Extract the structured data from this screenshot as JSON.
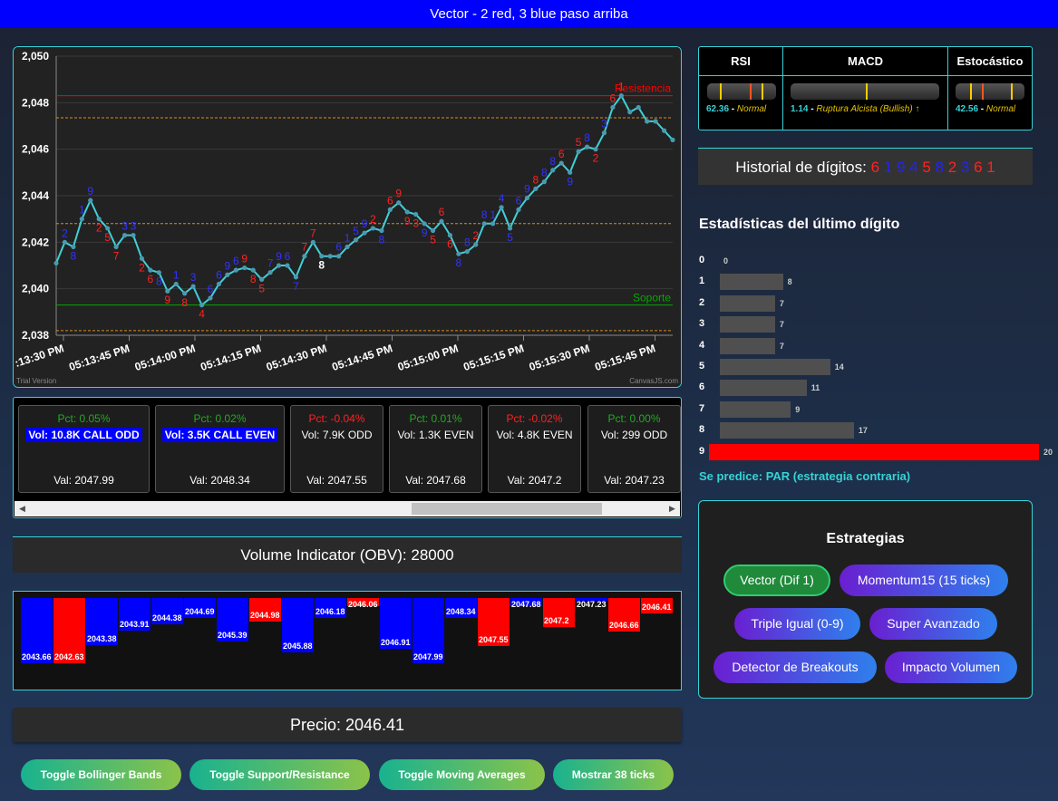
{
  "header": {
    "title": "Vector - 2 red, 3 blue paso arriba"
  },
  "chart": {
    "chart_data": {
      "type": "line",
      "ylim": [
        2038,
        2050
      ],
      "y_ticks": [
        "2,038",
        "2,040",
        "2,042",
        "2,044",
        "2,046",
        "2,048",
        "2,050"
      ],
      "x_ticks": [
        ":13:30 PM",
        "05:13:45 PM",
        "05:14:00 PM",
        "05:14:15 PM",
        "05:14:30 PM",
        "05:14:45 PM",
        "05:15:00 PM",
        "05:15:15 PM",
        "05:15:30 PM",
        "05:15:45 PM"
      ],
      "resistance": {
        "label": "Resistencia",
        "value": 2048.3,
        "color": "#ff0000"
      },
      "support": {
        "label": "Soporte",
        "value": 2039.3,
        "color": "#00aa00"
      },
      "dotted_levels": [
        2047.35,
        2042.8,
        2038.2
      ],
      "line_color": "#3fd0d8",
      "values": [
        2041.1,
        2042.0,
        2041.8,
        2043.0,
        2043.8,
        2043.0,
        2042.6,
        2041.8,
        2042.3,
        2042.3,
        2041.3,
        2040.8,
        2040.7,
        2039.9,
        2040.2,
        2039.8,
        2040.1,
        2039.3,
        2039.6,
        2040.2,
        2040.6,
        2040.8,
        2040.9,
        2040.8,
        2040.4,
        2040.7,
        2041.0,
        2041.0,
        2040.5,
        2041.4,
        2042.0,
        2041.4,
        2041.4,
        2041.4,
        2041.8,
        2042.1,
        2042.4,
        2042.6,
        2042.5,
        2043.4,
        2043.7,
        2043.3,
        2043.2,
        2042.8,
        2042.5,
        2042.9,
        2042.3,
        2041.5,
        2041.6,
        2041.9,
        2042.8,
        2042.8,
        2043.5,
        2042.6,
        2043.4,
        2043.9,
        2044.3,
        2044.6,
        2045.1,
        2045.4,
        2045.0,
        2045.9,
        2046.1,
        2046.0,
        2046.7,
        2047.8,
        2048.3,
        2047.6,
        2047.8,
        2047.2,
        2047.2,
        2046.8,
        2046.4
      ],
      "digit_labels": [
        {
          "i": 1,
          "t": "2",
          "c": "b"
        },
        {
          "i": 2,
          "t": "8",
          "c": "b"
        },
        {
          "i": 3,
          "t": "1",
          "c": "b"
        },
        {
          "i": 4,
          "t": "9",
          "c": "b"
        },
        {
          "i": 5,
          "t": "2",
          "c": "r"
        },
        {
          "i": 6,
          "t": "5",
          "c": "r"
        },
        {
          "i": 7,
          "t": "7",
          "c": "r"
        },
        {
          "i": 8,
          "t": "3",
          "c": "b"
        },
        {
          "i": 9,
          "t": "3",
          "c": "b"
        },
        {
          "i": 10,
          "t": "2",
          "c": "r"
        },
        {
          "i": 11,
          "t": "6",
          "c": "r"
        },
        {
          "i": 12,
          "t": "8",
          "c": "b"
        },
        {
          "i": 13,
          "t": "9",
          "c": "r"
        },
        {
          "i": 14,
          "t": "1",
          "c": "b"
        },
        {
          "i": 15,
          "t": "8",
          "c": "r"
        },
        {
          "i": 16,
          "t": "3",
          "c": "b"
        },
        {
          "i": 17,
          "t": "4",
          "c": "r"
        },
        {
          "i": 18,
          "t": "6",
          "c": "b"
        },
        {
          "i": 19,
          "t": "6",
          "c": "b"
        },
        {
          "i": 20,
          "t": "9",
          "c": "b"
        },
        {
          "i": 21,
          "t": "6",
          "c": "b"
        },
        {
          "i": 22,
          "t": "9",
          "c": "r"
        },
        {
          "i": 23,
          "t": "8",
          "c": "r"
        },
        {
          "i": 24,
          "t": "5",
          "c": "r"
        },
        {
          "i": 25,
          "t": "7",
          "c": "b"
        },
        {
          "i": 26,
          "t": "9",
          "c": "b"
        },
        {
          "i": 27,
          "t": "6",
          "c": "b"
        },
        {
          "i": 28,
          "t": "7",
          "c": "b"
        },
        {
          "i": 29,
          "t": "7",
          "c": "r"
        },
        {
          "i": 30,
          "t": "7",
          "c": "r"
        },
        {
          "i": 31,
          "t": "8",
          "c": "w"
        },
        {
          "i": 33,
          "t": "6",
          "c": "b"
        },
        {
          "i": 34,
          "t": "1",
          "c": "b"
        },
        {
          "i": 35,
          "t": "5",
          "c": "b"
        },
        {
          "i": 36,
          "t": "9",
          "c": "b"
        },
        {
          "i": 37,
          "t": "2",
          "c": "r"
        },
        {
          "i": 38,
          "t": "8",
          "c": "b"
        },
        {
          "i": 39,
          "t": "6",
          "c": "r"
        },
        {
          "i": 40,
          "t": "9",
          "c": "r"
        },
        {
          "i": 41,
          "t": "9",
          "c": "r"
        },
        {
          "i": 42,
          "t": "3",
          "c": "r"
        },
        {
          "i": 43,
          "t": "9",
          "c": "b"
        },
        {
          "i": 44,
          "t": "5",
          "c": "r"
        },
        {
          "i": 45,
          "t": "6",
          "c": "r"
        },
        {
          "i": 46,
          "t": "6",
          "c": "r"
        },
        {
          "i": 47,
          "t": "8",
          "c": "b"
        },
        {
          "i": 48,
          "t": "8",
          "c": "b"
        },
        {
          "i": 49,
          "t": "2",
          "c": "r"
        },
        {
          "i": 50,
          "t": "8",
          "c": "b"
        },
        {
          "i": 51,
          "t": "1",
          "c": "b"
        },
        {
          "i": 52,
          "t": "4",
          "c": "b"
        },
        {
          "i": 53,
          "t": "5",
          "c": "b"
        },
        {
          "i": 54,
          "t": "6",
          "c": "b"
        },
        {
          "i": 55,
          "t": "9",
          "c": "b"
        },
        {
          "i": 56,
          "t": "8",
          "c": "r"
        },
        {
          "i": 57,
          "t": "8",
          "c": "b"
        },
        {
          "i": 58,
          "t": "8",
          "c": "b"
        },
        {
          "i": 59,
          "t": "6",
          "c": "r"
        },
        {
          "i": 60,
          "t": "9",
          "c": "b"
        },
        {
          "i": 61,
          "t": "5",
          "c": "r"
        },
        {
          "i": 62,
          "t": "8",
          "c": "b"
        },
        {
          "i": 63,
          "t": "2",
          "c": "r"
        },
        {
          "i": 64,
          "t": "3",
          "c": "b"
        },
        {
          "i": 65,
          "t": "6",
          "c": "r"
        },
        {
          "i": 66,
          "t": "1",
          "c": "r"
        }
      ],
      "watermark_left": "Trial Version",
      "watermark_right": "CanvasJS.com"
    }
  },
  "ticks": [
    {
      "pct": "Pct: 0.05%",
      "pct_color": "#22aa22",
      "vol": "Vol: 10.8K CALL ODD",
      "highlight": true,
      "val": "Val: 2047.99"
    },
    {
      "pct": "Pct: 0.02%",
      "pct_color": "#22aa22",
      "vol": "Vol: 3.5K CALL EVEN",
      "highlight": true,
      "val": "Val: 2048.34"
    },
    {
      "pct": "Pct: -0.04%",
      "pct_color": "#ff2222",
      "vol": "Vol: 7.9K ODD",
      "highlight": false,
      "val": "Val: 2047.55"
    },
    {
      "pct": "Pct: 0.01%",
      "pct_color": "#22aa22",
      "vol": "Vol: 1.3K EVEN",
      "highlight": false,
      "val": "Val: 2047.68"
    },
    {
      "pct": "Pct: -0.02%",
      "pct_color": "#ff2222",
      "vol": "Vol: 4.8K EVEN",
      "highlight": false,
      "val": "Val: 2047.2"
    },
    {
      "pct": "Pct: 0.00%",
      "pct_color": "#22aa22",
      "vol": "Vol: 299 ODD",
      "highlight": false,
      "val": "Val: 2047.23"
    }
  ],
  "scroll": {
    "left": "◀",
    "right": "▶"
  },
  "obv": {
    "text": "Volume Indicator (OBV): 28000"
  },
  "vol_bars": [
    {
      "v": "2043.66",
      "c": "blue",
      "d": 1.0
    },
    {
      "v": "2042.63",
      "c": "red",
      "d": 1.0
    },
    {
      "v": "2043.38",
      "c": "blue",
      "d": 0.72
    },
    {
      "v": "2043.91",
      "c": "blue",
      "d": 0.5
    },
    {
      "v": "2044.38",
      "c": "blue",
      "d": 0.4
    },
    {
      "v": "2044.69",
      "c": "blue",
      "d": 0.3
    },
    {
      "v": "2045.39",
      "c": "blue",
      "d": 0.67
    },
    {
      "v": "2044.98",
      "c": "red",
      "d": 0.36
    },
    {
      "v": "2045.88",
      "c": "blue",
      "d": 0.83
    },
    {
      "v": "2046.18",
      "c": "blue",
      "d": 0.3
    },
    {
      "v": "2046.06",
      "c": "red",
      "d": 0.12
    },
    {
      "v": "2046.91",
      "c": "blue",
      "d": 0.78
    },
    {
      "v": "2047.99",
      "c": "blue",
      "d": 1.0
    },
    {
      "v": "2048.34",
      "c": "blue",
      "d": 0.3
    },
    {
      "v": "2047.55",
      "c": "red",
      "d": 0.74
    },
    {
      "v": "2047.68",
      "c": "blue",
      "d": 0.12
    },
    {
      "v": "2047.2",
      "c": "red",
      "d": 0.45
    },
    {
      "v": "2047.23",
      "c": "blue",
      "d": 0.03
    },
    {
      "v": "2046.66",
      "c": "red",
      "d": 0.52
    },
    {
      "v": "2046.41",
      "c": "red",
      "d": 0.23
    }
  ],
  "price": {
    "text": "Precio: 2046.41"
  },
  "toggles": [
    "Toggle Bollinger Bands",
    "Toggle Support/Resistance",
    "Toggle Moving Averages",
    "Mostrar 38 ticks"
  ],
  "indicators": {
    "rsi": {
      "title": "RSI",
      "value": "62.36",
      "sep": " - ",
      "status": "Normal"
    },
    "macd": {
      "title": "MACD",
      "value": "1.14",
      "sep": " - ",
      "status": "Ruptura Alcista (Bullish) ↑"
    },
    "stoch": {
      "title": "Estocástico",
      "value": "42.56",
      "sep": " - ",
      "status": "Normal"
    }
  },
  "digits": {
    "label": "Historial de dígitos:",
    "seq": [
      {
        "d": "6",
        "c": "#ff2222"
      },
      {
        "d": "1",
        "c": "#2222ff"
      },
      {
        "d": "9",
        "c": "#2222ff"
      },
      {
        "d": "4",
        "c": "#2222ff"
      },
      {
        "d": "5",
        "c": "#ff2222"
      },
      {
        "d": "8",
        "c": "#2222ff"
      },
      {
        "d": "2",
        "c": "#ff2222"
      },
      {
        "d": "3",
        "c": "#2222ff"
      },
      {
        "d": "6",
        "c": "#ff2222"
      },
      {
        "d": "1",
        "c": "#ff2222"
      }
    ]
  },
  "stats": {
    "title": "Estadísticas del último dígito",
    "rows": [
      {
        "d": "0",
        "n": 0
      },
      {
        "d": "1",
        "n": 8
      },
      {
        "d": "2",
        "n": 7
      },
      {
        "d": "3",
        "n": 7
      },
      {
        "d": "4",
        "n": 7
      },
      {
        "d": "5",
        "n": 14
      },
      {
        "d": "6",
        "n": 11
      },
      {
        "d": "7",
        "n": 9
      },
      {
        "d": "8",
        "n": 17
      },
      {
        "d": "9",
        "n": 20
      }
    ],
    "max_color": "#ff0000"
  },
  "prediction": {
    "text": "Se predice: PAR (estrategia contraria)"
  },
  "strategies": {
    "title": "Estrategias",
    "buttons": [
      "Vector (Dif 1)",
      "Momentum15 (15 ticks)",
      "Triple Igual (0-9)",
      "Super Avanzado",
      "Detector de Breakouts",
      "Impacto Volumen"
    ],
    "active": "Vector (Dif 1)"
  }
}
